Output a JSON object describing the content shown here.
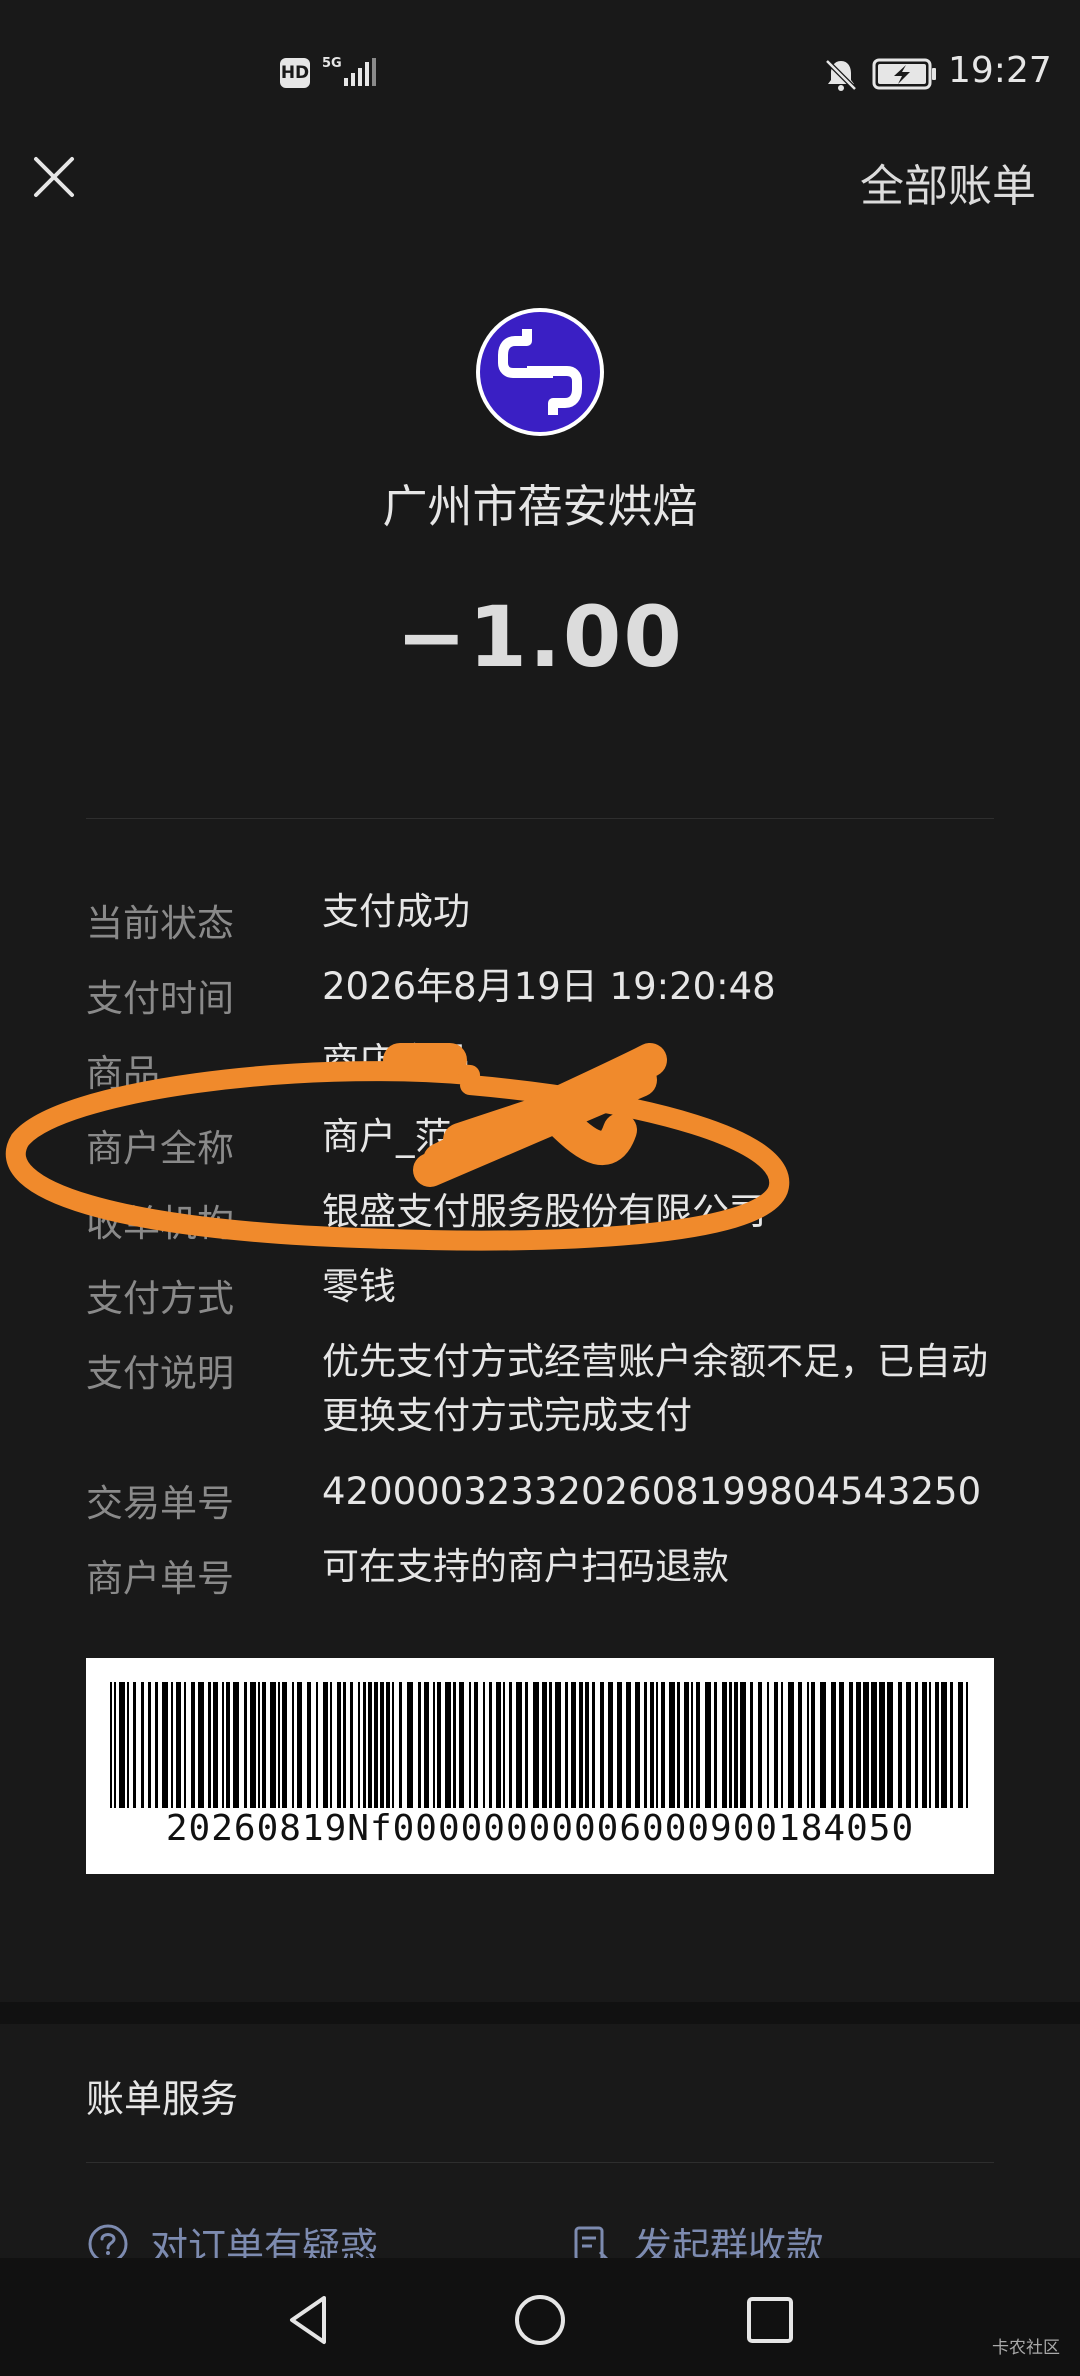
{
  "status_bar": {
    "hd": "HD",
    "network": "5G",
    "time": "19:27"
  },
  "header": {
    "all_bills": "全部账单"
  },
  "merchant": {
    "name": "广州市蓓安烘焙",
    "amount": "−1.00",
    "logo_color": "#3a1fc4"
  },
  "details": [
    {
      "label": "当前状态",
      "value": "支付成功"
    },
    {
      "label": "支付时间",
      "value": "2026年8月19日 19:20:48"
    },
    {
      "label": "商品",
      "value": "商店商品"
    },
    {
      "label": "商户全称",
      "value": "商户_范"
    },
    {
      "label": "收单机构",
      "value": "银盛支付服务股份有限公司"
    },
    {
      "label": "支付方式",
      "value": "零钱"
    },
    {
      "label": "支付说明",
      "value": "优先支付方式经营账户余额不足，已自动更换支付方式完成支付"
    },
    {
      "label": "交易单号",
      "value": "4200003233202608199804543250"
    },
    {
      "label": "商户单号",
      "value": "可在支持的商户扫码退款"
    }
  ],
  "barcode": {
    "number": "20260819Nf00000000006000900184050"
  },
  "services": {
    "title": "账单服务",
    "question": "对订单有疑惑",
    "group_collect": "发起群收款"
  },
  "watermark": "卡农社区",
  "colors": {
    "annotation": "#f08a2c",
    "link": "#7d8bb0"
  }
}
